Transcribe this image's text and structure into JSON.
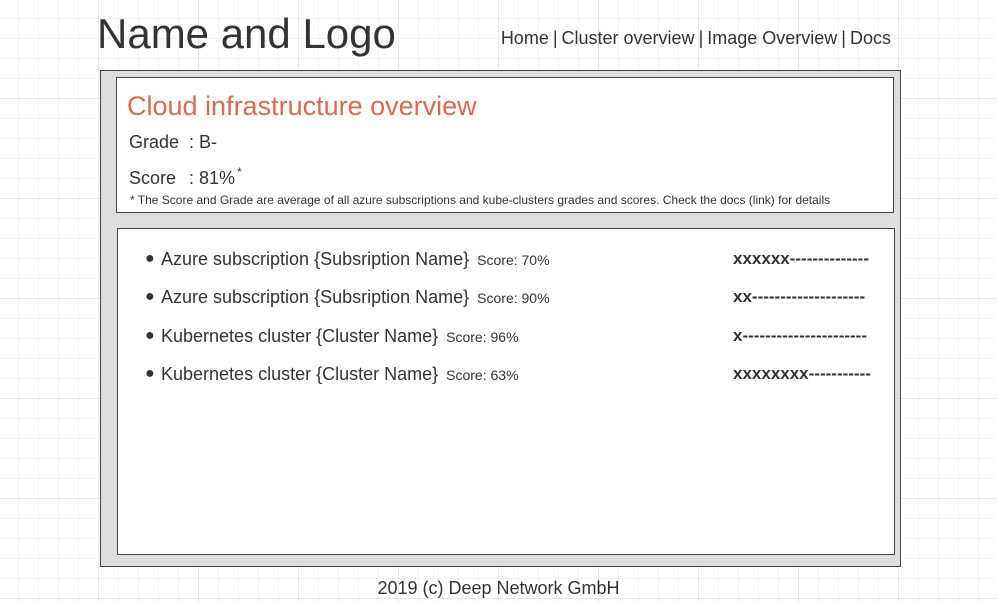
{
  "header": {
    "logo_text": "Name and Logo",
    "nav": [
      "Home",
      "Cluster overview",
      "Image Overview",
      "Docs"
    ],
    "nav_separator": "|"
  },
  "overview": {
    "title": "Cloud infrastructure overview",
    "grade_label": "Grade",
    "grade_value": ": B-",
    "score_label": "Score",
    "score_value": ": 81%",
    "score_marker": "*",
    "footnote": "* The Score and Grade are average of all azure subscriptions and kube-clusters grades and scores. Check the docs (link) for details"
  },
  "items": [
    {
      "name": "Azure subscription {Subsription Name}",
      "score": "Score: 70%",
      "bar": "xxxxxx--------------"
    },
    {
      "name": "Azure subscription {Subsription Name}",
      "score": "Score: 90%",
      "bar": "xx--------------------"
    },
    {
      "name": "Kubernetes cluster {Cluster Name}",
      "score": "Score: 96%",
      "bar": "x----------------------"
    },
    {
      "name": "Kubernetes cluster {Cluster Name}",
      "score": "Score: 63%",
      "bar": "xxxxxxxx-----------"
    }
  ],
  "footer": {
    "text": "2019 (c) Deep Network GmbH"
  },
  "colors": {
    "accent": "#e0684b",
    "text": "#333333",
    "frame": "#dddddd"
  }
}
